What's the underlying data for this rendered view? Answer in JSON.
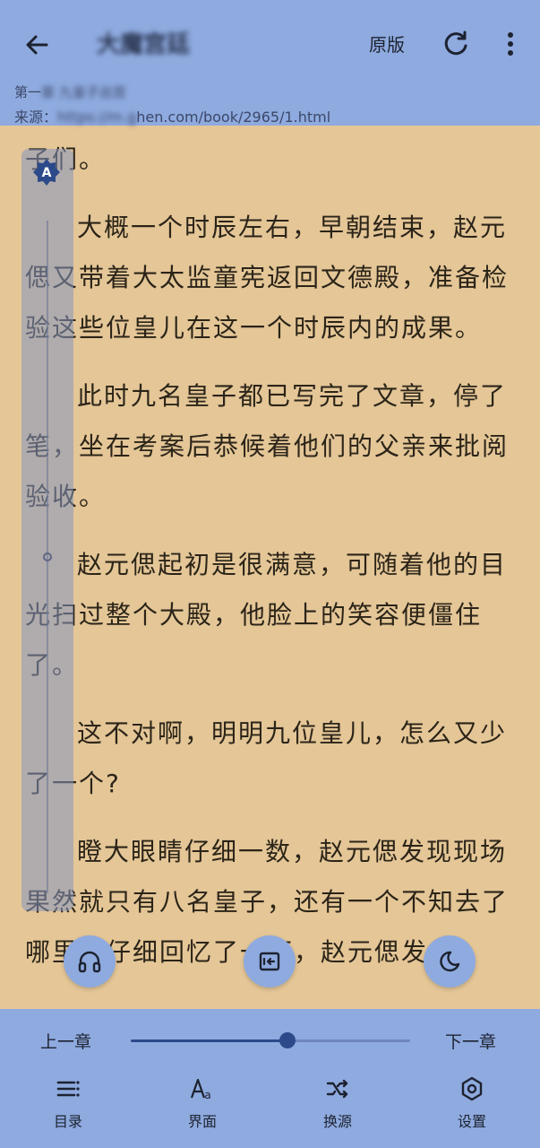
{
  "topbar": {
    "title": "大魔宫廷",
    "original_label": "原版",
    "chapter_prefix": "第一",
    "chapter_blurred": "章  九皇子出宫",
    "source_label": "来源：",
    "source_url_blurred": "https://m.g",
    "source_url_visible": "hen.com/book/2965/1.html"
  },
  "content": {
    "paragraphs": [
      "子们。",
      "大概一个时辰左右，早朝结束，赵元偲又带着大太监童宪返回文德殿，准备检验这些位皇儿在这一个时辰内的成果。",
      "此时九名皇子都已写完了文章，停了笔，坐在考案后恭候着他们的父亲来批阅验收。",
      "赵元偲起初是很满意，可随着他的目光扫过整个大殿，他脸上的笑容便僵住了。",
      "这不对啊，明明九位皇儿，怎么又少了一个?",
      "瞪大眼睛仔细一数，赵元偲发现现场果然就只有八名皇子，还有一个不知去了哪里，仔细回忆了一下，赵元偲发"
    ]
  },
  "side_slider": {
    "auto_icon_letter": "A",
    "level": 0.5
  },
  "fabs": {
    "listen_icon": "headphones-icon",
    "autopage_icon": "auto-page-icon",
    "night_icon": "moon-icon"
  },
  "bottom": {
    "prev_label": "上一章",
    "next_label": "下一章",
    "progress": 0.56,
    "nav": [
      {
        "label": "目录",
        "icon": "list-icon"
      },
      {
        "label": "界面",
        "icon": "font-icon"
      },
      {
        "label": "换源",
        "icon": "shuffle-icon"
      },
      {
        "label": "设置",
        "icon": "settings-icon"
      }
    ]
  },
  "colors": {
    "bar": "#8eaadf",
    "page": "#e4c697",
    "accent": "#2c4a8a"
  }
}
